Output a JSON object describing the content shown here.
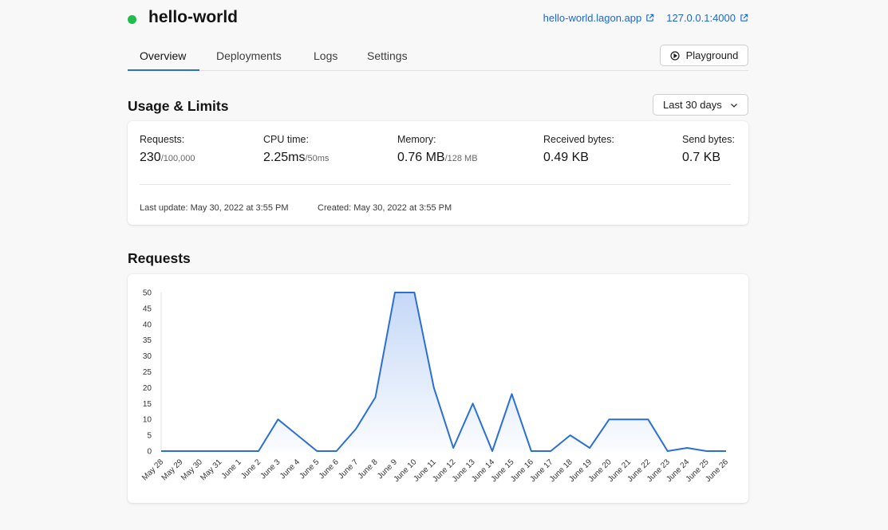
{
  "app": {
    "name": "hello-world",
    "status_color": "#1fbd4e",
    "links": [
      {
        "label": "hello-world.lagon.app",
        "icon": "external-link-icon"
      },
      {
        "label": "127.0.0.1:4000",
        "icon": "external-link-icon"
      }
    ]
  },
  "tabs": [
    {
      "label": "Overview",
      "active": true
    },
    {
      "label": "Deployments",
      "active": false
    },
    {
      "label": "Logs",
      "active": false
    },
    {
      "label": "Settings",
      "active": false
    }
  ],
  "playground": {
    "label": "Playground",
    "icon": "play-circle-icon"
  },
  "usage": {
    "title": "Usage & Limits",
    "range": "Last 30 days",
    "stats": [
      {
        "label": "Requests:",
        "value": "230",
        "limit": "/100,000"
      },
      {
        "label": "CPU time:",
        "value": "2.25ms",
        "limit": "/50ms"
      },
      {
        "label": "Memory:",
        "value": "0.76 MB",
        "limit": "/128 MB"
      },
      {
        "label": "Received bytes:",
        "value": "0.49 KB",
        "limit": ""
      },
      {
        "label": "Send bytes:",
        "value": "0.7 KB",
        "limit": ""
      }
    ],
    "last_update": "Last update: May 30, 2022 at 3:55 PM",
    "created": "Created: May 30, 2022 at 3:55 PM"
  },
  "requests_section": {
    "title": "Requests"
  },
  "chart_data": {
    "type": "area",
    "title": "",
    "xlabel": "",
    "ylabel": "",
    "ylim": [
      0,
      50
    ],
    "yticks": [
      0,
      5,
      10,
      15,
      20,
      25,
      30,
      35,
      40,
      45,
      50
    ],
    "grid": false,
    "line_color": "#2b6fd6",
    "fill_color": "#c5d8f7",
    "categories": [
      "May 28",
      "May 29",
      "May 30",
      "May 31",
      "June 1",
      "June 2",
      "June 3",
      "June 4",
      "June 5",
      "June 6",
      "June 7",
      "June 8",
      "June 9",
      "June 10",
      "June 11",
      "June 12",
      "June 13",
      "June 14",
      "June 15",
      "June 16",
      "June 17",
      "June 18",
      "June 19",
      "June 20",
      "June 21",
      "June 22",
      "June 23",
      "June 24",
      "June 25",
      "June 26"
    ],
    "series": [
      {
        "values": [
          0,
          0,
          0,
          0,
          0,
          0,
          10,
          5,
          0,
          0,
          7,
          17,
          50,
          50,
          20,
          1,
          15,
          0,
          18,
          0,
          0,
          5,
          1,
          10,
          10,
          10,
          0,
          1,
          0,
          0
        ]
      }
    ]
  }
}
